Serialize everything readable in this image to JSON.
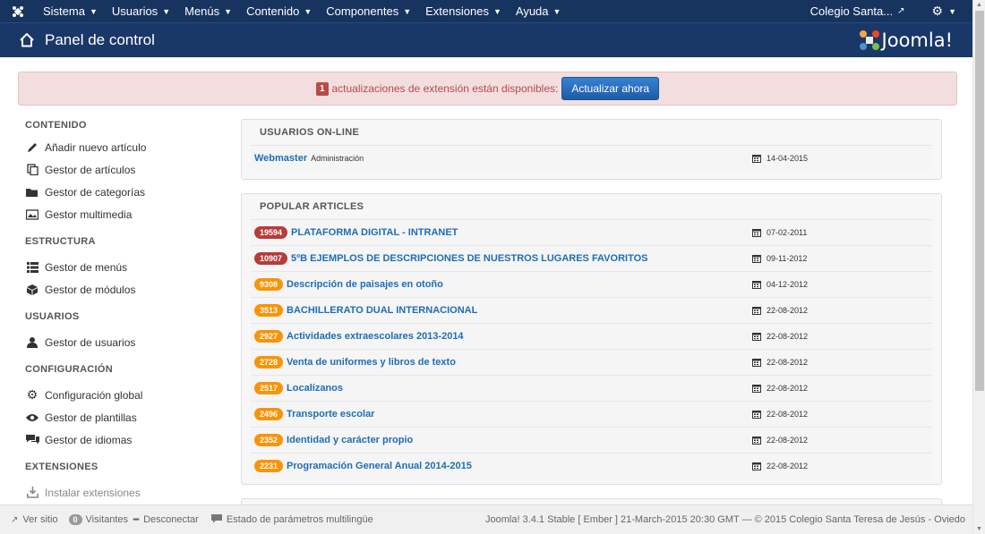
{
  "navbar": {
    "menus": [
      "Sistema",
      "Usuarios",
      "Menús",
      "Contenido",
      "Componentes",
      "Extensiones",
      "Ayuda"
    ],
    "site_name": "Colegio Santa..."
  },
  "header": {
    "title": "Panel de control",
    "brand": "Joomla!"
  },
  "alert": {
    "count": "1",
    "message": "actualizaciones de extensión están disponibles:",
    "button": "Actualizar ahora"
  },
  "sidebar": {
    "sections": [
      {
        "heading": "CONTENIDO",
        "items": [
          "Añadir nuevo artículo",
          "Gestor de artículos",
          "Gestor de categorías",
          "Gestor multimedia"
        ]
      },
      {
        "heading": "ESTRUCTURA",
        "items": [
          "Gestor de menús",
          "Gestor de módulos"
        ]
      },
      {
        "heading": "USUARIOS",
        "items": [
          "Gestor de usuarios"
        ]
      },
      {
        "heading": "CONFIGURACIÓN",
        "items": [
          "Configuración global",
          "Gestor de plantillas",
          "Gestor de idiomas"
        ]
      },
      {
        "heading": "EXTENSIONES",
        "items": [
          "Instalar extensiones"
        ]
      }
    ]
  },
  "online": {
    "title": "USUARIOS ON-LINE",
    "user": "Webmaster",
    "role": "Administración",
    "date": "14-04-2015"
  },
  "popular": {
    "title": "POPULAR ARTICLES",
    "articles": [
      {
        "hits": "19594",
        "title": "PLATAFORMA DIGITAL - INTRANET",
        "date": "07-02-2011",
        "level": "important"
      },
      {
        "hits": "10907",
        "title": "5ºB EJEMPLOS DE DESCRIPCIONES DE NUESTROS LUGARES FAVORITOS",
        "date": "09-11-2012",
        "level": "important"
      },
      {
        "hits": "9308",
        "title": "Descripción de paisajes en otoño",
        "date": "04-12-2012",
        "level": "warning"
      },
      {
        "hits": "3513",
        "title": "BACHILLERATO DUAL INTERNACIONAL",
        "date": "22-08-2012",
        "level": "warning"
      },
      {
        "hits": "2927",
        "title": "Actividades extraescolares 2013-2014",
        "date": "22-08-2012",
        "level": "warning"
      },
      {
        "hits": "2728",
        "title": "Venta de uniformes y libros de texto",
        "date": "22-08-2012",
        "level": "warning"
      },
      {
        "hits": "2517",
        "title": "Localízanos",
        "date": "22-08-2012",
        "level": "warning"
      },
      {
        "hits": "2496",
        "title": "Transporte escolar",
        "date": "22-08-2012",
        "level": "warning"
      },
      {
        "hits": "2352",
        "title": "Identidad y carácter propio",
        "date": "22-08-2012",
        "level": "warning"
      },
      {
        "hits": "2231",
        "title": "Programación General Anual 2014-2015",
        "date": "22-08-2012",
        "level": "warning"
      }
    ]
  },
  "footer": {
    "view_site": "Ver sitio",
    "visitors_count": "0",
    "visitors": "Visitantes",
    "logout": "Desconectar",
    "multilang": "Estado de parámetros multilingüe",
    "copyright": "Joomla! 3.4.1 Stable [ Ember ] 21-March-2015 20:30 GMT — © 2015 Colegio Santa Teresa de Jesús - Oviedo"
  },
  "colors": {
    "navbar": "#17345f",
    "header": "#1a3867",
    "link": "#1f6db3",
    "badge_important": "#b63c3a",
    "badge_warning": "#f89406"
  }
}
